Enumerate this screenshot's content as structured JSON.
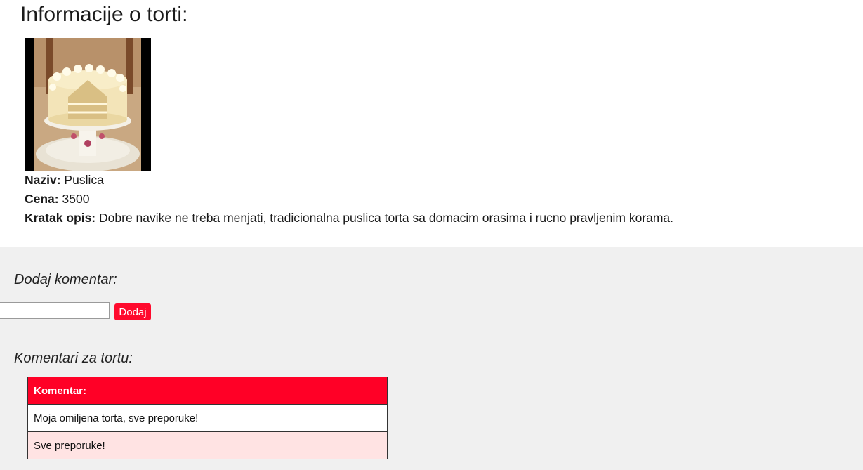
{
  "info": {
    "title": "Informacije o torti:",
    "image_alt": "cake-photo",
    "naziv_label": "Naziv:",
    "naziv_value": "Puslica",
    "cena_label": "Cena:",
    "cena_value": "3500",
    "opis_label": "Kratak opis:",
    "opis_value": "Dobre navike ne treba menjati, tradicionalna puslica torta sa domacim orasima i rucno pravljenim korama."
  },
  "add_comment": {
    "title": "Dodaj komentar:",
    "input_value": "",
    "input_placeholder": "",
    "button_label": "Dodaj"
  },
  "comments": {
    "title": "Komentari za tortu:",
    "header": "Komentar:",
    "rows": [
      "Moja omiljena torta, sve preporuke!",
      "Sve preporuke!"
    ]
  },
  "colors": {
    "accent": "#ff0026",
    "row_alt": "#ffe3e3",
    "section_bg": "#f0f0f0"
  }
}
